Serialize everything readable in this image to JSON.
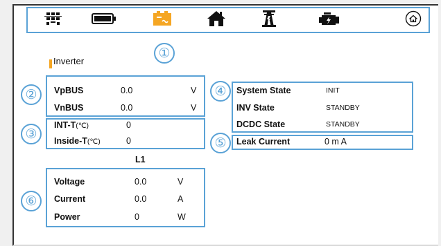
{
  "toolbar": {
    "icons": [
      "grid-icon",
      "battery-icon",
      "pv-panel-icon",
      "home-icon",
      "grid-tower-icon",
      "generator-icon",
      "home-button-icon"
    ],
    "active_icon": "pv-panel-icon",
    "active_color": "#f5a623"
  },
  "markers": [
    "①",
    "②",
    "③",
    "④",
    "⑤",
    "⑥"
  ],
  "section_title": "Inverter",
  "bus": [
    {
      "label": "VpBUS",
      "value": "0.0",
      "unit": "V"
    },
    {
      "label": "VnBUS",
      "value": "0.0",
      "unit": "V"
    }
  ],
  "temps": [
    {
      "label": "INT-T",
      "unit_suffix": "(℃)",
      "value": "0"
    },
    {
      "label": "Inside-T",
      "unit_suffix": "(℃)",
      "value": "0"
    }
  ],
  "states": [
    {
      "label": "System State",
      "value": "INIT"
    },
    {
      "label": "INV State",
      "value": "STANDBY"
    },
    {
      "label": "DCDC State",
      "value": "STANDBY"
    }
  ],
  "leak": {
    "label": "Leak Current",
    "value": "0 m A"
  },
  "phase_label": "L1",
  "phase": [
    {
      "label": "Voltage",
      "value": "0.0",
      "unit": "V"
    },
    {
      "label": "Current",
      "value": "0.0",
      "unit": "A"
    },
    {
      "label": "Power",
      "value": "0",
      "unit": "W"
    }
  ],
  "colors": {
    "annotation": "#5aa2d6",
    "accent": "#f5a623",
    "icon": "#111111"
  }
}
